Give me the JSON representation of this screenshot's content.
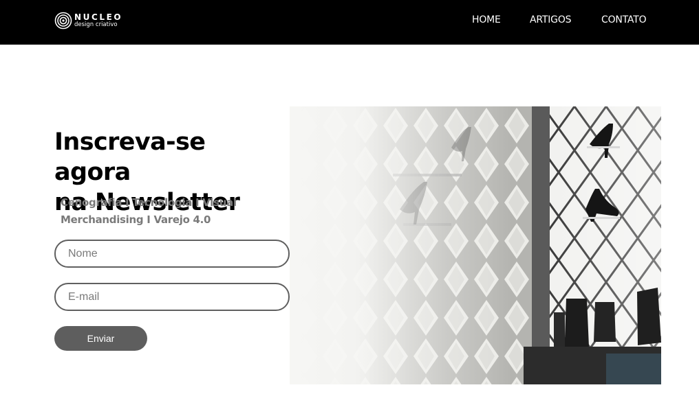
{
  "header": {
    "logo": {
      "word": "NUCLEO",
      "tagline": "design criativo"
    },
    "nav": [
      {
        "label": "HOME"
      },
      {
        "label": "ARTIGOS"
      },
      {
        "label": "CONTATO"
      }
    ]
  },
  "newsletter": {
    "title_line1": "Inscreva-se agora",
    "title_line2": "na Newsletter",
    "subtitle_line1": "Cenografia I Tecnologia I Visual",
    "subtitle_line2": "Merchandising I Varejo 4.0",
    "name_placeholder": "Nome",
    "email_placeholder": "E-mail",
    "submit_label": "Enviar"
  },
  "theme": {
    "header_bg": "#000000",
    "button_bg": "#5e5e5e",
    "field_border": "#5f5f5f",
    "subtitle_color": "#7a7a7a"
  },
  "hero_image": {
    "subject": "shoe-store-lattice-display-photo"
  }
}
